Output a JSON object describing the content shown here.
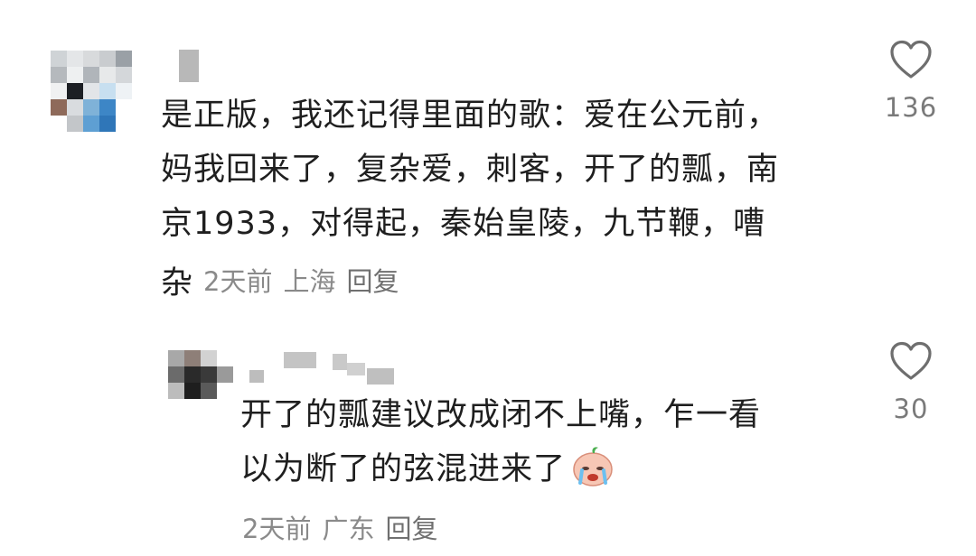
{
  "comments": [
    {
      "text_lines": [
        "是正版，我还记得里面的歌：爱在公元前，",
        "妈我回来了，复杂爱，刺客，开了的瓢，南",
        "京1933，对得起，秦始皇陵，九节鞭，嘈"
      ],
      "last_line": "杂",
      "time": "2天前",
      "location": "上海",
      "reply_label": "回复",
      "likes": "136",
      "like_icon": "heart-outline-icon"
    },
    {
      "text_lines": [
        "开了的瓢建议改成闭不上嘴，乍一看",
        "以为断了的弦混进来了"
      ],
      "emoji": "crying-face-emoji",
      "time": "2天前",
      "location": "广东",
      "reply_label": "回复",
      "likes": "30",
      "like_icon": "heart-outline-icon"
    }
  ],
  "colors": {
    "text": "#1f1f1f",
    "meta": "#8a8a8a",
    "icon": "#6e6e6e"
  }
}
